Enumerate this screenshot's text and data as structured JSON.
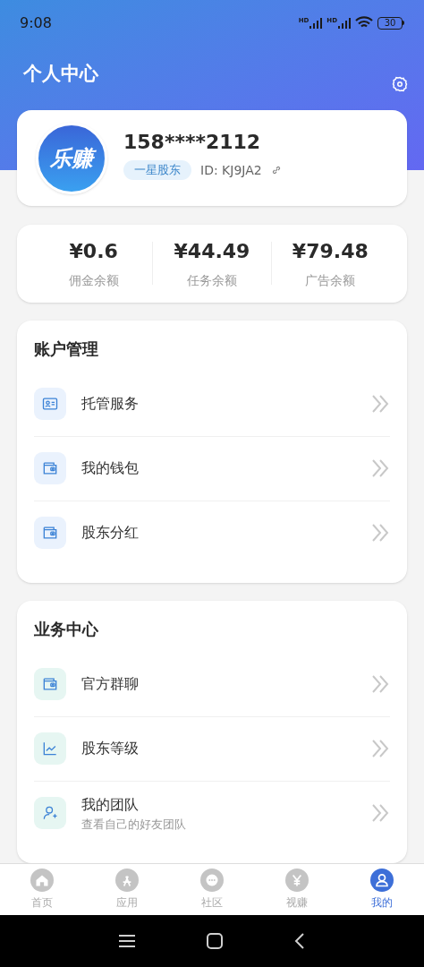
{
  "status_bar": {
    "time": "9:08",
    "signal_badges": [
      "HD",
      "HD"
    ],
    "battery": "30"
  },
  "header": {
    "title": "个人中心"
  },
  "profile": {
    "avatar_text": "乐赚",
    "phone": "158****2112",
    "badge": "一星股东",
    "id": "ID: KJ9JA2"
  },
  "balances": [
    {
      "amount": "¥0.6",
      "label": "佣金余额"
    },
    {
      "amount": "¥44.49",
      "label": "任务余额"
    },
    {
      "amount": "¥79.48",
      "label": "广告余额"
    }
  ],
  "sections": [
    {
      "title": "账户管理",
      "items": [
        {
          "kind": "card",
          "label": "托管服务"
        },
        {
          "kind": "wallet",
          "label": "我的钱包"
        },
        {
          "kind": "wallet",
          "label": "股东分红"
        }
      ]
    },
    {
      "title": "业务中心",
      "items": [
        {
          "kind": "wallet",
          "label": "官方群聊"
        },
        {
          "kind": "chart",
          "label": "股东等级"
        },
        {
          "kind": "user",
          "label": "我的团队",
          "subtitle": "查看自己的好友团队"
        }
      ]
    }
  ],
  "tabs": [
    {
      "kind": "home",
      "label": "首页",
      "selected": false
    },
    {
      "kind": "apps",
      "label": "应用",
      "selected": false
    },
    {
      "kind": "chat",
      "label": "社区",
      "selected": false
    },
    {
      "kind": "yuan",
      "label": "视赚",
      "selected": false
    },
    {
      "kind": "user",
      "label": "我的",
      "selected": true
    }
  ]
}
